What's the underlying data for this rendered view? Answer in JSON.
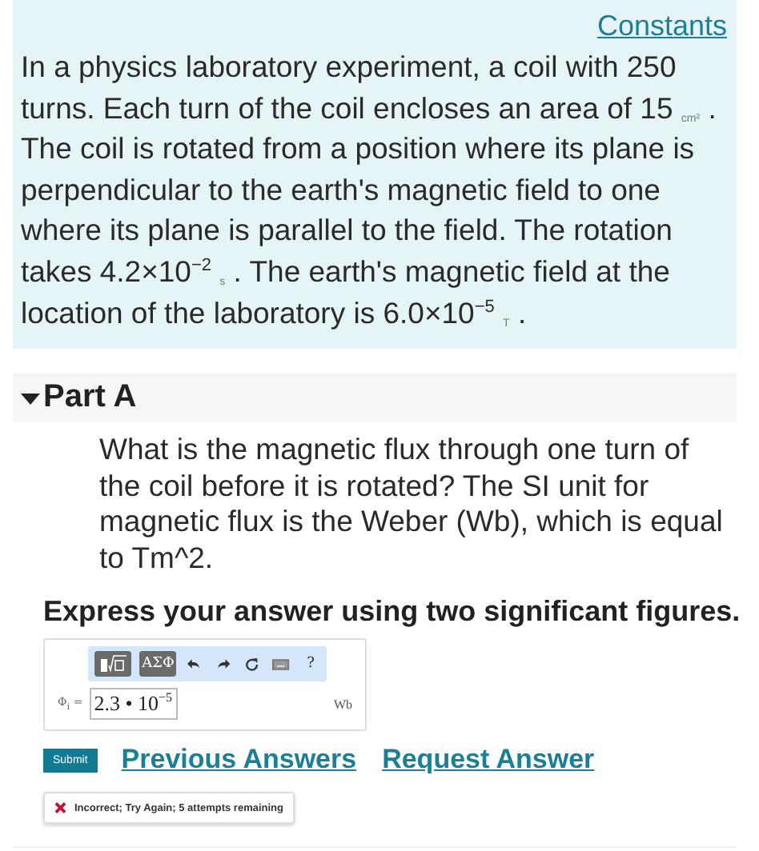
{
  "intro": {
    "link": "Constants",
    "text": "In a physics laboratory experiment, a coil with 250 turns. Each turn of the coil encloses an area of 15 $_{cm²}$ . The coil is rotated from a position where its plane is perpendicular to the earth's magnetic field to one where its plane is parallel to the field. The rotation takes 4.2×10$^{−2}$ $_{s}$ . The earth's magnetic field at the location of the laboratory is 6.0×10$^{−5}$ $_{T}$ ."
  },
  "part": {
    "title": "Part A",
    "expanded": true,
    "question": "What is the magnetic flux through one turn of the coil before it is rotated? The SI unit for magnetic flux is the Weber (Wb), which is equal to Tm^2.",
    "instruction": "Express your answer using two significant figures."
  },
  "answer": {
    "toolbar": [
      {
        "kind": "templates"
      },
      {
        "kind": "symbols",
        "label": "ΑΣΦ"
      },
      {
        "kind": "undo"
      },
      {
        "kind": "redo"
      },
      {
        "kind": "reset"
      },
      {
        "kind": "keyboard"
      },
      {
        "kind": "help",
        "label": "?"
      }
    ],
    "variable": "Φ$_{i}$ =",
    "value": "2.3 • 10$^{−5}$",
    "unit": "Wb"
  },
  "actions": {
    "submit": "Submit",
    "links": [
      "Previous Answers",
      "Request Answer"
    ]
  },
  "feedback": {
    "correct": false,
    "text": "Incorrect; Try Again; 5 attempts remaining"
  }
}
